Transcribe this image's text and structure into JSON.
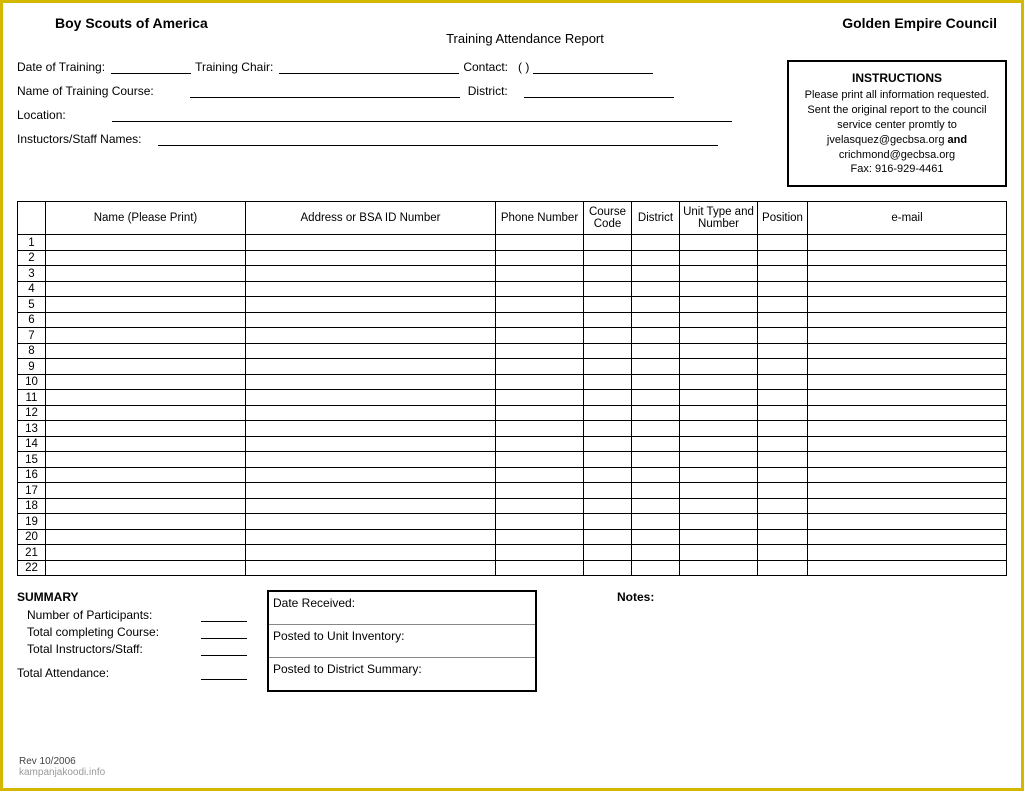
{
  "header": {
    "org": "Boy Scouts of America",
    "title": "Training Attendance Report",
    "council": "Golden Empire Council"
  },
  "meta": {
    "date_label": "Date of Training:",
    "chair_label": "Training Chair:",
    "contact_label": "Contact:",
    "contact_paren": "(          )",
    "course_label": "Name of Training Course:",
    "district_label": "District:",
    "location_label": "Location:",
    "instructors_label": "Instuctors/Staff Names:"
  },
  "instructions": {
    "title": "INSTRUCTIONS",
    "line1": "Please print all information requested.",
    "line2": "Sent the original report to the council service center promtly to",
    "email1": "jvelasquez@gecbsa.org",
    "and": "and",
    "email2": "crichmond@gecbsa.org",
    "fax": "Fax: 916-929-4461"
  },
  "columns": {
    "num": "",
    "name": "Name (Please Print)",
    "addr": "Address or BSA ID Number",
    "phone": "Phone Number",
    "code": "Course Code",
    "district": "District",
    "unit": "Unit Type and Number",
    "position": "Position",
    "email": "e-mail"
  },
  "rows": [
    "1",
    "2",
    "3",
    "4",
    "5",
    "6",
    "7",
    "8",
    "9",
    "10",
    "11",
    "12",
    "13",
    "14",
    "15",
    "16",
    "17",
    "18",
    "19",
    "20",
    "21",
    "22"
  ],
  "summary": {
    "title": "SUMMARY",
    "participants": "Number of Participants:",
    "completing": "Total completing Course:",
    "instructors": "Total Instructors/Staff:",
    "attendance": "Total Attendance:"
  },
  "receipt": {
    "date_received": "Date Received:",
    "posted_unit": "Posted to Unit Inventory:",
    "posted_district": "Posted to District Summary:"
  },
  "notes_label": "Notes:",
  "footer": {
    "rev": "Rev 10/2006",
    "watermark": "kampanjakoodi.info"
  }
}
